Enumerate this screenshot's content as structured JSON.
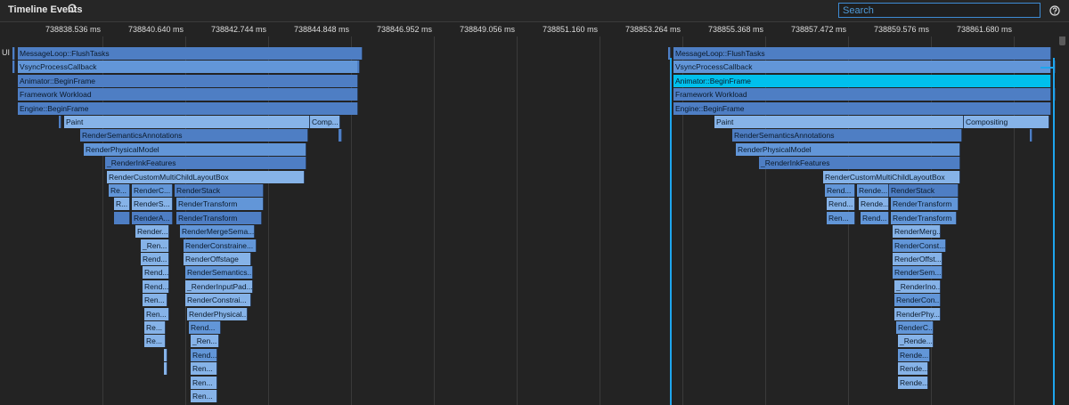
{
  "header": {
    "title": "Timeline Events",
    "search_placeholder": "Search"
  },
  "lane_label": "UI",
  "ruler_ticks": [
    "738838.536 ms",
    "738840.640 ms",
    "738842.744 ms",
    "738844.848 ms",
    "738846.952 ms",
    "738849.056 ms",
    "738851.160 ms",
    "738853.264 ms",
    "738855.368 ms",
    "738857.472 ms",
    "738859.576 ms",
    "738861.680 ms"
  ],
  "events_left": [
    "MessageLoop::FlushTasks",
    "VsyncProcessCallback",
    "Animator::BeginFrame",
    "Framework Workload",
    "Engine::BeginFrame",
    "Paint",
    "Comp...",
    "RenderSemanticsAnnotations",
    "RenderPhysicalModel",
    "_RenderInkFeatures",
    "RenderCustomMultiChildLayoutBox",
    "Re...",
    "RenderC...",
    "RenderStack",
    "R...",
    "RenderS...",
    "RenderTransform",
    "RenderA...",
    "RenderTransform",
    "Render...",
    "RenderMergeSema...",
    "_Ren...",
    "RenderConstraine...",
    "Rend...",
    "RenderOffstage",
    "Rend...",
    "RenderSemantics...",
    "Rend...",
    "_RenderInputPad...",
    "Ren...",
    "RenderConstrai...",
    "Ren...",
    "RenderPhysical...",
    "Re...",
    "Rend...",
    "Re...",
    "_Ren...",
    "Rend...",
    "Ren...",
    "Ren...",
    "Ren..."
  ],
  "events_right": [
    "MessageLoop::FlushTasks",
    "VsyncProcessCallback",
    "Animator::BeginFrame",
    "Framework Workload",
    "Engine::BeginFrame",
    "Paint",
    "Compositing",
    "RenderSemanticsAnnotations",
    "RenderPhysicalModel",
    "_RenderInkFeatures",
    "RenderCustomMultiChildLayoutBox",
    "Rend...",
    "Rende...",
    "RenderStack",
    "Rend...",
    "Rende...",
    "RenderTransform",
    "Ren...",
    "Rend...",
    "RenderTransform",
    "RenderMerg...",
    "RenderConst...",
    "RenderOffst...",
    "RenderSem...",
    "_RenderIno...",
    "RenderCon...",
    "RenderPhy...",
    "RenderC...",
    "_Rende...",
    "Rende...",
    "Rende...",
    "Rende..."
  ]
}
